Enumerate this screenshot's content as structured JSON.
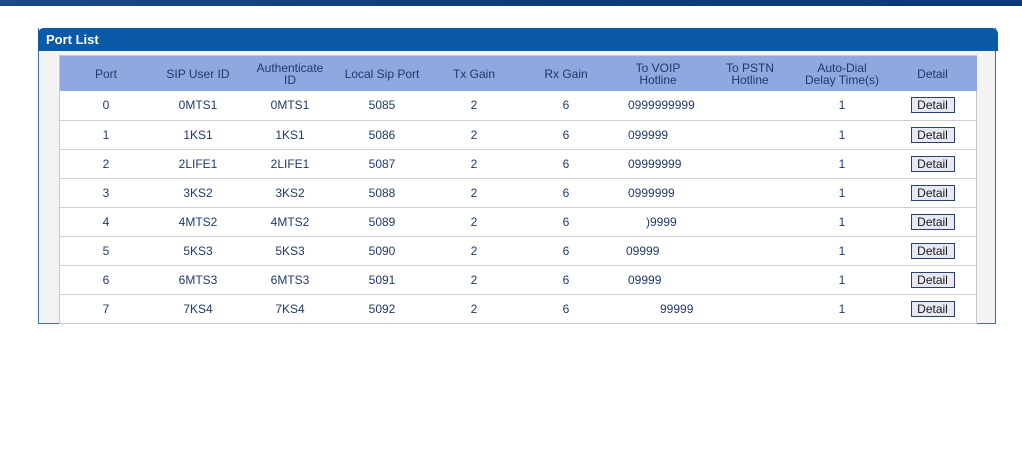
{
  "panel": {
    "title": "Port List"
  },
  "table": {
    "headers": {
      "port": "Port",
      "sip_user_id": "SIP User ID",
      "authenticate_id": [
        "Authenticate",
        "ID"
      ],
      "local_sip_port": "Local Sip Port",
      "tx_gain": "Tx Gain",
      "rx_gain": "Rx Gain",
      "to_voip_hotline": [
        "To VOIP",
        "Hotline"
      ],
      "to_pstn_hotline": [
        "To PSTN",
        "Hotline"
      ],
      "auto_dial": [
        "Auto-Dial",
        "Delay Time(s)"
      ],
      "detail": "Detail"
    },
    "rows": [
      {
        "port": "0",
        "sip_user_id": "0MTS1",
        "auth_id": "0MTS1",
        "local_sip_port": "5085",
        "tx_gain": "2",
        "rx_gain": "6",
        "voip_hotline": "0999999999",
        "pstn_hotline": "",
        "delay": "1",
        "detail": "Detail"
      },
      {
        "port": "1",
        "sip_user_id": "1KS1",
        "auth_id": "1KS1",
        "local_sip_port": "5086",
        "tx_gain": "2",
        "rx_gain": "6",
        "voip_hotline": "099999",
        "pstn_hotline": "",
        "delay": "1",
        "detail": "Detail"
      },
      {
        "port": "2",
        "sip_user_id": "2LIFE1",
        "auth_id": "2LIFE1",
        "local_sip_port": "5087",
        "tx_gain": "2",
        "rx_gain": "6",
        "voip_hotline": "09999999",
        "pstn_hotline": "",
        "delay": "1",
        "detail": "Detail"
      },
      {
        "port": "3",
        "sip_user_id": "3KS2",
        "auth_id": "3KS2",
        "local_sip_port": "5088",
        "tx_gain": "2",
        "rx_gain": "6",
        "voip_hotline": "0999999",
        "pstn_hotline": "",
        "delay": "1",
        "detail": "Detail"
      },
      {
        "port": "4",
        "sip_user_id": "4MTS2",
        "auth_id": "4MTS2",
        "local_sip_port": "5089",
        "tx_gain": "2",
        "rx_gain": "6",
        "voip_hotline": ")9999",
        "pstn_hotline": "",
        "delay": "1",
        "detail": "Detail"
      },
      {
        "port": "5",
        "sip_user_id": "5KS3",
        "auth_id": "5KS3",
        "local_sip_port": "5090",
        "tx_gain": "2",
        "rx_gain": "6",
        "voip_hotline": "09999",
        "pstn_hotline": "",
        "delay": "1",
        "detail": "Detail"
      },
      {
        "port": "6",
        "sip_user_id": "6MTS3",
        "auth_id": "6MTS3",
        "local_sip_port": "5091",
        "tx_gain": "2",
        "rx_gain": "6",
        "voip_hotline": "09999",
        "pstn_hotline": "",
        "delay": "1",
        "detail": "Detail"
      },
      {
        "port": "7",
        "sip_user_id": "7KS4",
        "auth_id": "7KS4",
        "local_sip_port": "5092",
        "tx_gain": "2",
        "rx_gain": "6",
        "voip_hotline": "99999",
        "pstn_hotline": "",
        "delay": "1",
        "detail": "Detail"
      }
    ]
  },
  "colors": {
    "header_bar": "#0b5aa7",
    "table_header": "#8fa8e0",
    "text": "#1f3a68",
    "top_banner": "#0d3c78"
  }
}
